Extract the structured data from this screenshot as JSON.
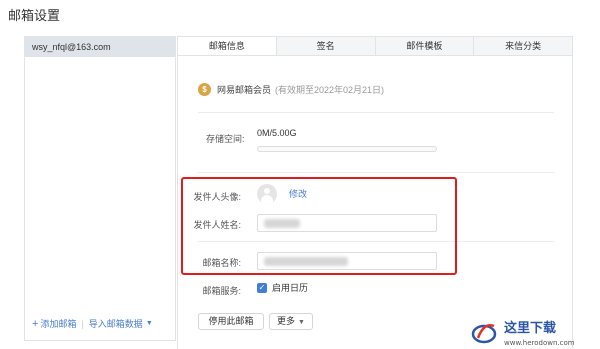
{
  "page_title": "邮箱设置",
  "sidebar": {
    "account": "wsy_nfql@163.com",
    "add_mailbox": "添加邮箱",
    "import_data": "导入邮箱数据"
  },
  "tabs": [
    {
      "label": "邮箱信息",
      "active": true
    },
    {
      "label": "签名",
      "active": false
    },
    {
      "label": "邮件模板",
      "active": false
    },
    {
      "label": "来信分类",
      "active": false
    }
  ],
  "vip": {
    "label": "网易邮箱会员",
    "expire": "(有效期至2022年02月21日)",
    "icon": "coin-icon"
  },
  "storage": {
    "label": "存储空间:",
    "value": "0M/5.00G",
    "used_fraction": 0
  },
  "sender": {
    "avatar_label": "发件人头像:",
    "edit": "修改",
    "name_label": "发件人姓名:",
    "mailbox_name_label": "邮箱名称:"
  },
  "service": {
    "label": "邮箱服务:",
    "calendar": "启用日历",
    "checked": true
  },
  "buttons": {
    "disable": "停用此邮箱",
    "more": "更多"
  },
  "colors": {
    "accent": "#4a7ccc",
    "highlight": "#e21b1b",
    "checkbox": "#3f7fd8"
  },
  "watermark": {
    "text": "这里下载",
    "url": "www.herodown.com"
  }
}
